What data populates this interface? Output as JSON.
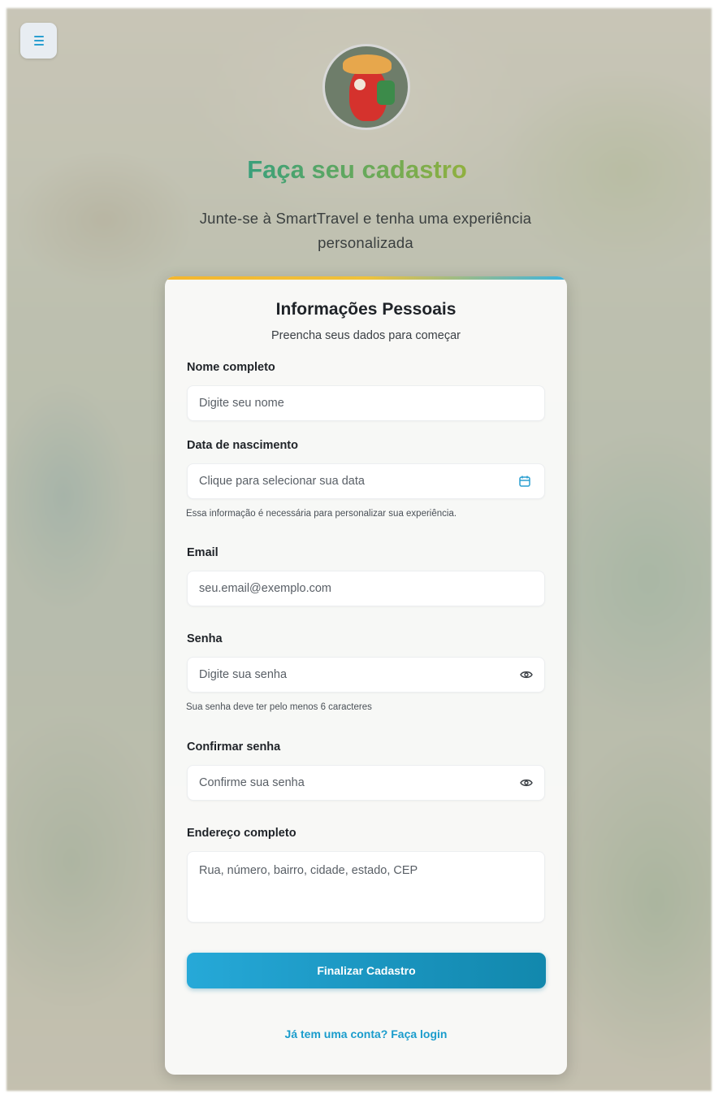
{
  "header": {
    "menu_icon": "menu-icon",
    "title": "Faça seu cadastro",
    "subtitle": "Junte-se à SmartTravel e tenha uma experiência personalizada"
  },
  "card": {
    "title": "Informações Pessoais",
    "subtitle": "Preencha seus dados para começar",
    "fields": {
      "name": {
        "label": "Nome completo",
        "placeholder": "Digite seu nome",
        "value": ""
      },
      "birthdate": {
        "label": "Data de nascimento",
        "placeholder": "Clique para selecionar sua data",
        "value": "",
        "hint": "Essa informação é necessária para personalizar sua experiência.",
        "icon": "calendar-icon"
      },
      "email": {
        "label": "Email",
        "placeholder": "seu.email@exemplo.com",
        "value": ""
      },
      "password": {
        "label": "Senha",
        "placeholder": "Digite sua senha",
        "value": "",
        "hint": "Sua senha deve ter pelo menos 6 caracteres",
        "icon": "eye-icon"
      },
      "confirm_password": {
        "label": "Confirmar senha",
        "placeholder": "Confirme sua senha",
        "value": "",
        "icon": "eye-icon"
      },
      "address": {
        "label": "Endereço completo",
        "placeholder": "Rua, número, bairro, cidade, estado, CEP",
        "value": ""
      }
    },
    "submit_label": "Finalizar Cadastro",
    "login_link": "Já tem uma conta? Faça login"
  },
  "colors": {
    "accent": "#1a9ccc",
    "button_start": "#26a9d8",
    "button_end": "#1288ad",
    "title_gradient": [
      "#2f8f86",
      "#8fb040",
      "#d3b029"
    ],
    "card_top_line": [
      "#f4b62e",
      "#3bb4e0"
    ]
  }
}
